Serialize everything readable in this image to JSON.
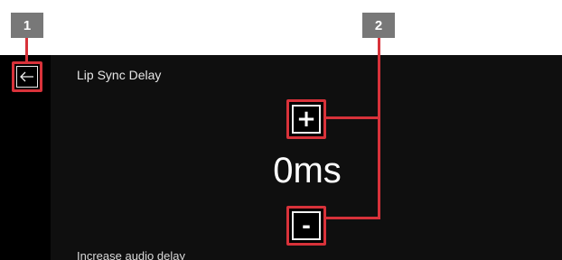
{
  "title": "Lip Sync Delay",
  "delay_value": "0ms",
  "plus_label": "+",
  "minus_label": "-",
  "hint": "Increase audio delay",
  "callouts": [
    "1",
    "2"
  ],
  "colors": {
    "accent": "#d8323a",
    "callout_bg": "#787878",
    "screen_bg": "#0f0f0f"
  }
}
